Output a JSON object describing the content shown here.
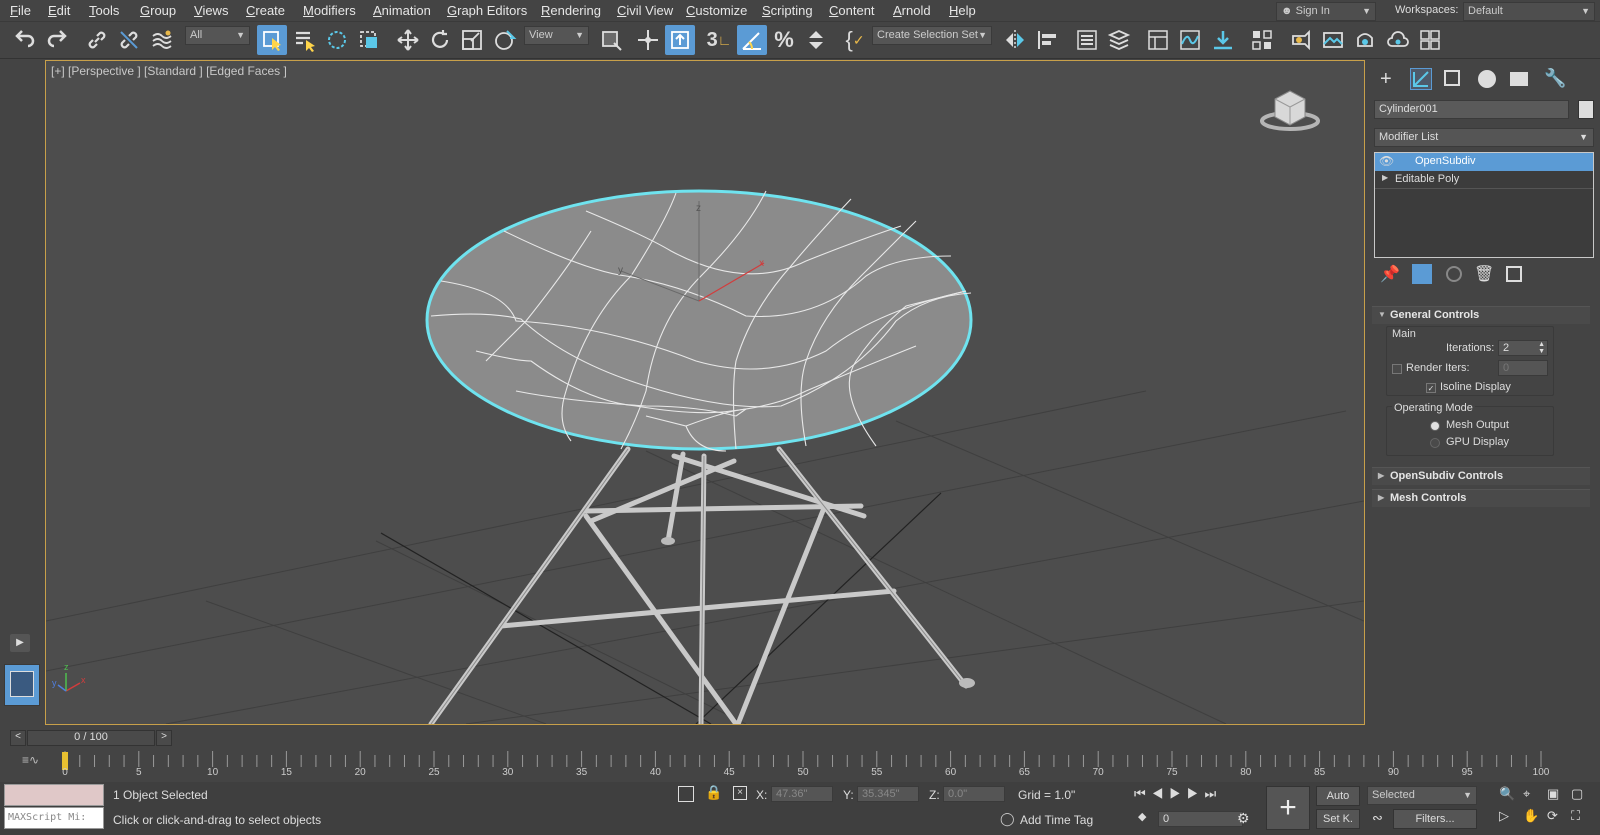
{
  "menu": [
    "File",
    "Edit",
    "Tools",
    "Group",
    "Views",
    "Create",
    "Modifiers",
    "Animation",
    "Graph Editors",
    "Rendering",
    "Civil View",
    "Customize",
    "Scripting",
    "Content",
    "Arnold",
    "Help"
  ],
  "account": {
    "sign_in": "Sign In",
    "workspaces_label": "Workspaces:",
    "workspace": "Default"
  },
  "toolbar": {
    "filter": "All",
    "ref_coord": "View",
    "selection_set": "Create Selection Set"
  },
  "viewport": {
    "label": "[+] [Perspective ] [Standard ] [Edged Faces ]",
    "axis_x": "x",
    "axis_y": "y",
    "axis_z": "z"
  },
  "command_panel": {
    "object_name": "Cylinder001",
    "modifier_list": "Modifier List",
    "stack": [
      "OpenSubdiv",
      "Editable Poly"
    ],
    "general_controls": "General Controls",
    "main": "Main",
    "iterations_label": "Iterations:",
    "iterations_value": "2",
    "render_iters_label": "Render Iters:",
    "render_iters_value": "0",
    "isoline_label": "Isoline Display",
    "operating_mode": "Operating Mode",
    "mesh_output": "Mesh Output",
    "gpu_display": "GPU Display",
    "opensubdiv_controls": "OpenSubdiv Controls",
    "mesh_controls": "Mesh Controls"
  },
  "timeline": {
    "frame": "0 / 100",
    "ticks": [
      "0",
      "5",
      "10",
      "15",
      "20",
      "25",
      "30",
      "35",
      "40",
      "45",
      "50",
      "55",
      "60",
      "65",
      "70",
      "75",
      "80",
      "85",
      "90",
      "95",
      "100"
    ]
  },
  "status": {
    "selected": "1 Object Selected",
    "hint": "Click or click-and-drag to select objects",
    "maxscript": "MAXScript Mi:",
    "x_label": "X:",
    "x_value": "47.36\"",
    "y_label": "Y:",
    "y_value": "35.345\"",
    "z_label": "Z:",
    "z_value": "0.0\"",
    "grid": "Grid = 1.0\"",
    "add_time_tag": "Add Time Tag",
    "auto": "Auto",
    "set_key": "Set K.",
    "selected_dd": "Selected",
    "filters": "Filters...",
    "frame_field": "0"
  },
  "colors": {
    "accent": "#5b9bd5",
    "viewport_border": "#c8a04a",
    "selection": "#6fe3ef"
  }
}
